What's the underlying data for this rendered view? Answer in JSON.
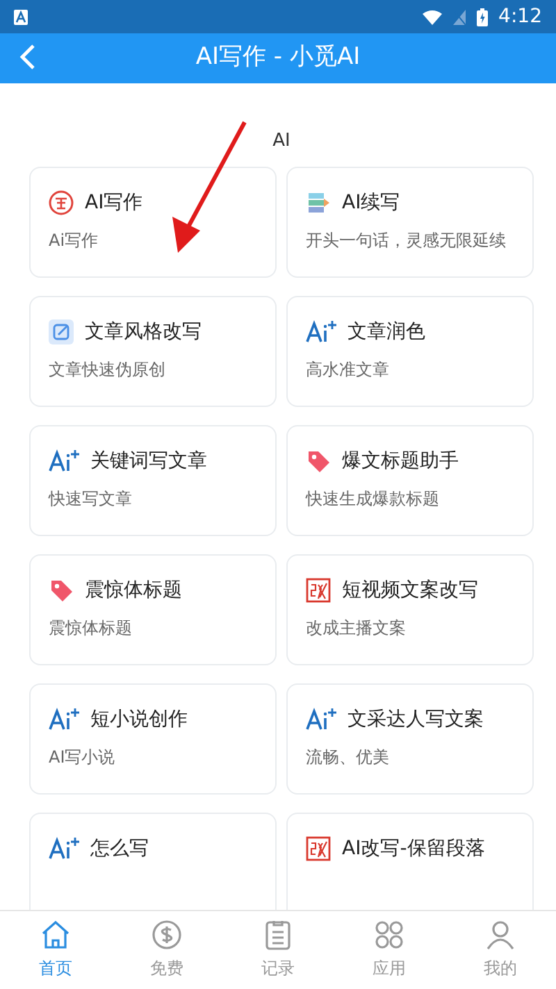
{
  "status_bar": {
    "time": "4:12"
  },
  "app_bar": {
    "title": "AI写作 - 小觅AI"
  },
  "section": {
    "title": "AI"
  },
  "cards": [
    {
      "kind": "write",
      "title": "AI写作",
      "subtitle": "Ai写作"
    },
    {
      "kind": "continue",
      "title": "AI续写",
      "subtitle": "开头一句话，灵感无限延续"
    },
    {
      "kind": "edit",
      "title": "文章风格改写",
      "subtitle": "文章快速伪原创"
    },
    {
      "kind": "ai",
      "title": "文章润色",
      "subtitle": "高水准文章"
    },
    {
      "kind": "ai",
      "title": "关键词写文章",
      "subtitle": "快速写文章"
    },
    {
      "kind": "tag",
      "title": "爆文标题助手",
      "subtitle": "快速生成爆款标题"
    },
    {
      "kind": "tag",
      "title": "震惊体标题",
      "subtitle": "震惊体标题"
    },
    {
      "kind": "rewrite",
      "title": "短视频文案改写",
      "subtitle": "改成主播文案"
    },
    {
      "kind": "ai",
      "title": "短小说创作",
      "subtitle": "AI写小说"
    },
    {
      "kind": "ai",
      "title": "文采达人写文案",
      "subtitle": "流畅、优美"
    },
    {
      "kind": "ai",
      "title": "怎么写"
    },
    {
      "kind": "rewrite",
      "title": "AI改写-保留段落"
    }
  ],
  "bottom_nav": [
    {
      "kind": "home",
      "label": "首页",
      "selected": true
    },
    {
      "kind": "coin",
      "label": "免费",
      "selected": false
    },
    {
      "kind": "clipboard",
      "label": "记录",
      "selected": false
    },
    {
      "kind": "apps",
      "label": "应用",
      "selected": false
    },
    {
      "kind": "person",
      "label": "我的",
      "selected": false
    }
  ]
}
